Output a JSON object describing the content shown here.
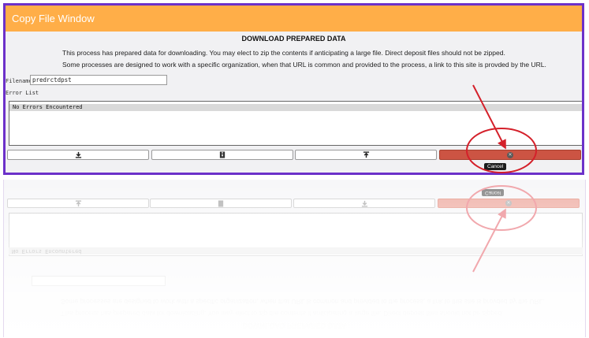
{
  "window": {
    "title": "Copy File Window",
    "heading": "DOWNLOAD PREPARED DATA",
    "paragraph1": "This process has prepared data for downloading. You may elect to zip the contents if anticipating a large file. Direct deposit files should not be zipped.",
    "paragraph2": "Some processes are designed to work with a specific organization, when that URL is common and provided to the process, a link to this site is provded by the URL."
  },
  "filename": {
    "label": "Filename",
    "value": "predrctdpst"
  },
  "errors": {
    "label": "Error List",
    "items": [
      "No Errors Encountered"
    ]
  },
  "buttons": [
    {
      "icon": "download-icon"
    },
    {
      "icon": "zip-file-icon"
    },
    {
      "icon": "upload-icon"
    },
    {
      "icon": "close-circle-icon",
      "tooltip": "Cancel"
    }
  ],
  "colors": {
    "titlebar": "#ffae48",
    "border": "#6c31c9",
    "cancel_button": "#cc5443",
    "annotation": "#d4202a"
  }
}
